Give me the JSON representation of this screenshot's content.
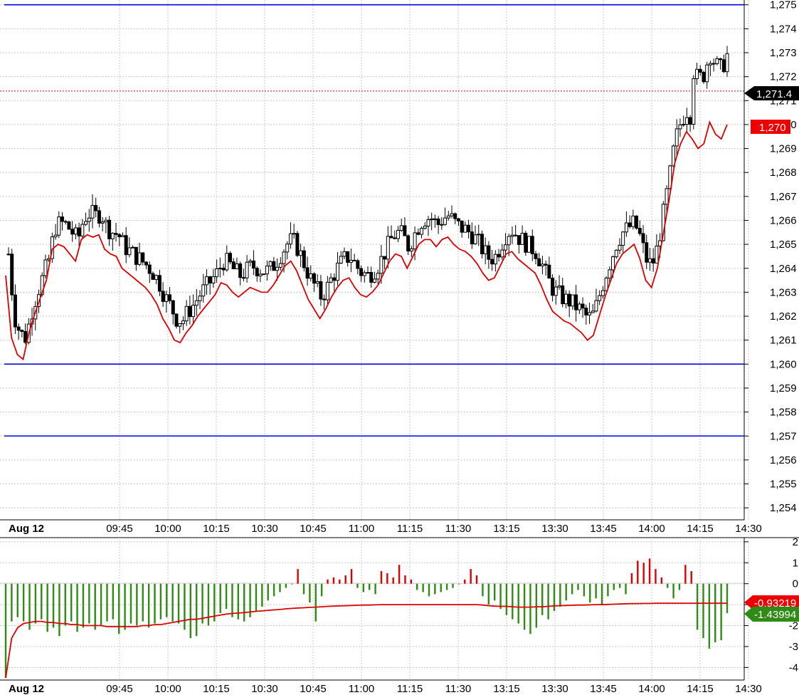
{
  "chart_data": [
    {
      "type": "candlestick",
      "panel": "price",
      "title": "",
      "xlabel": "",
      "ylabel": "",
      "date_label": "Aug 12",
      "x_ticks": [
        "09:45",
        "10:00",
        "10:15",
        "10:30",
        "10:45",
        "11:00",
        "11:15",
        "11:30",
        "13:15",
        "13:30",
        "13:45",
        "14:00",
        "14:15",
        "14:30"
      ],
      "y_ticks": [
        "1,254",
        "1,255",
        "1,256",
        "1,257",
        "1,258",
        "1,259",
        "1,260",
        "1,261",
        "1,262",
        "1,263",
        "1,264",
        "1,265",
        "1,266",
        "1,267",
        "1,268",
        "1,269",
        "1,270",
        "1,271",
        "1,272",
        "1,273",
        "1,274",
        "1,275"
      ],
      "ylim": [
        1253.5,
        1275.2
      ],
      "grid": true,
      "horizontal_lines": [
        1275,
        1260,
        1257
      ],
      "last_price_line": 1271.4,
      "last_price_label": "1,271.4",
      "red_line_label": "1,270",
      "close_line": [
        1263.7,
        1261.1,
        1260.4,
        1260.2,
        1261.3,
        1262.1,
        1262.8,
        1263.5,
        1264.8,
        1265.0,
        1264.9,
        1264.6,
        1264.3,
        1265.2,
        1265.4,
        1265.3,
        1265.4,
        1264.8,
        1264.6,
        1264.5,
        1264.0,
        1263.8,
        1263.6,
        1263.4,
        1263.2,
        1262.9,
        1262.5,
        1261.9,
        1261.5,
        1261.0,
        1260.9,
        1261.3,
        1261.6,
        1262.0,
        1262.3,
        1262.6,
        1262.9,
        1263.4,
        1263.3,
        1263.0,
        1262.8,
        1263.0,
        1263.2,
        1263.1,
        1263.0,
        1263.0,
        1263.3,
        1263.7,
        1264.1,
        1264.3,
        1263.9,
        1263.3,
        1262.7,
        1262.3,
        1261.9,
        1262.3,
        1262.8,
        1263.2,
        1263.5,
        1263.6,
        1263.2,
        1262.9,
        1262.8,
        1263.0,
        1263.3,
        1263.8,
        1264.3,
        1264.6,
        1264.5,
        1264.0,
        1264.5,
        1265.0,
        1265.2,
        1265.2,
        1264.9,
        1265.2,
        1265.3,
        1265.0,
        1264.8,
        1264.7,
        1264.5,
        1264.2,
        1263.8,
        1263.5,
        1263.6,
        1264.1,
        1264.6,
        1264.7,
        1264.4,
        1264.2,
        1264.0,
        1263.8,
        1263.3,
        1262.7,
        1262.2,
        1262.0,
        1261.8,
        1261.7,
        1261.5,
        1261.3,
        1261.0,
        1261.2,
        1262.0,
        1262.8,
        1263.5,
        1264.2,
        1264.6,
        1264.8,
        1265.0,
        1264.4,
        1263.5,
        1263.2,
        1264.0,
        1265.4,
        1266.8,
        1268.4,
        1269.2,
        1269.7,
        1269.4,
        1269.0,
        1269.2,
        1270.1,
        1269.6,
        1269.4,
        1270.0
      ]
    },
    {
      "type": "bar",
      "panel": "oscillator",
      "y_ticks": [
        "2",
        "1",
        "0",
        "-1",
        "-2",
        "-3",
        "-4"
      ],
      "ylim": [
        -4.6,
        2.2
      ],
      "histogram_value_label": "-1.43994",
      "signal_value_label": "-0.93219",
      "positive_color": "#dd0000",
      "negative_color": "#2e8b13",
      "signal_color": "#dd0000",
      "histogram": [
        -4.5,
        -1.8,
        -1.6,
        -1.8,
        -2.2,
        -1.9,
        -1.7,
        -2.3,
        -2.1,
        -2.5,
        -2.0,
        -1.8,
        -2.3,
        -2.1,
        -1.9,
        -2.2,
        -2.0,
        -1.8,
        -1.7,
        -2.4,
        -2.2,
        -1.9,
        -2.0,
        -1.8,
        -2.1,
        -1.9,
        -1.7,
        -1.6,
        -1.8,
        -1.9,
        -2.2,
        -2.6,
        -2.5,
        -1.9,
        -2.0,
        -1.8,
        -1.4,
        -1.2,
        -1.6,
        -1.7,
        -1.8,
        -1.6,
        -1.3,
        -1.1,
        -0.8,
        -0.6,
        -0.4,
        -0.2,
        0.0,
        0.7,
        -0.5,
        -0.9,
        -1.8,
        -0.6,
        0.2,
        0.3,
        0.2,
        0.4,
        0.7,
        -0.2,
        -0.4,
        -0.3,
        -0.5,
        0.6,
        0.5,
        0.3,
        0.9,
        0.4,
        0.2,
        -0.3,
        -0.4,
        -0.6,
        -0.5,
        -0.4,
        -0.3,
        -0.2,
        0.0,
        0.2,
        0.7,
        0.4,
        -0.6,
        -1.0,
        -0.8,
        -1.2,
        -1.5,
        -1.7,
        -1.9,
        -2.2,
        -2.4,
        -2.1,
        -1.5,
        -1.7,
        -1.3,
        -1.1,
        -0.8,
        -0.5,
        -0.3,
        -0.6,
        -0.9,
        -0.7,
        -1.0,
        -0.6,
        -0.3,
        -0.2,
        -0.5,
        0.5,
        1.1,
        1.0,
        1.2,
        0.7,
        0.3,
        -0.2,
        -0.7,
        -0.3,
        0.9,
        0.6,
        -2.2,
        -2.6,
        -3.1,
        -2.8,
        -2.7,
        -1.4
      ],
      "signal": [
        -4.5,
        -2.6,
        -2.1,
        -1.9,
        -1.85,
        -1.8,
        -1.8,
        -1.85,
        -1.85,
        -1.9,
        -1.9,
        -1.95,
        -1.95,
        -2.0,
        -2.0,
        -2.0,
        -2.0,
        -2.05,
        -2.05,
        -2.05,
        -2.05,
        -2.05,
        -2.05,
        -2.0,
        -2.0,
        -1.95,
        -1.95,
        -1.9,
        -1.85,
        -1.8,
        -1.75,
        -1.7,
        -1.7,
        -1.65,
        -1.6,
        -1.55,
        -1.5,
        -1.45,
        -1.42,
        -1.4,
        -1.38,
        -1.35,
        -1.32,
        -1.3,
        -1.27,
        -1.25,
        -1.23,
        -1.2,
        -1.18,
        -1.16,
        -1.15,
        -1.13,
        -1.12,
        -1.1,
        -1.08,
        -1.07,
        -1.06,
        -1.05,
        -1.04,
        -1.03,
        -1.02,
        -1.02,
        -1.01,
        -1.0,
        -1.0,
        -1.0,
        -1.0,
        -1.0,
        -1.0,
        -1.0,
        -1.0,
        -1.0,
        -1.0,
        -1.0,
        -1.0,
        -1.0,
        -1.0,
        -1.0,
        -1.0,
        -1.0,
        -1.02,
        -1.05,
        -1.07,
        -1.08,
        -1.08,
        -1.1,
        -1.12,
        -1.12,
        -1.12,
        -1.1,
        -1.1,
        -1.08,
        -1.06,
        -1.05,
        -1.04,
        -1.03,
        -1.02,
        -1.02,
        -1.01,
        -1.0,
        -1.0,
        -0.99,
        -0.98,
        -0.97,
        -0.96,
        -0.95,
        -0.95,
        -0.94,
        -0.94,
        -0.93,
        -0.93,
        -0.93,
        -0.93,
        -0.93,
        -0.93,
        -0.93,
        -0.93,
        -0.93,
        -0.93,
        -0.93,
        -0.93,
        -0.93
      ]
    }
  ]
}
